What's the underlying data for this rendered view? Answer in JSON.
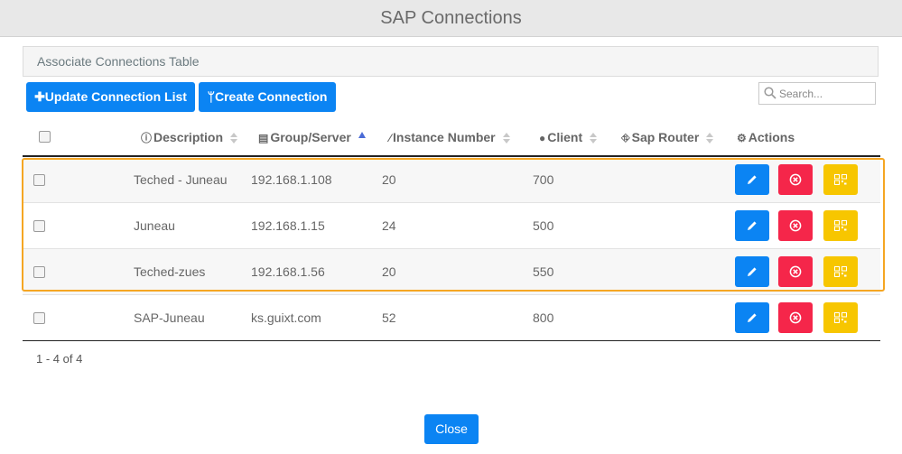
{
  "modal": {
    "title": "SAP Connections"
  },
  "panel": {
    "heading": "Associate Connections Table"
  },
  "toolbar": {
    "update_label": "Update Connection List",
    "create_label": "Create Connection",
    "search_placeholder": "Search..."
  },
  "columns": {
    "description": "Description",
    "group_server": "Group/Server",
    "instance_number": "Instance Number",
    "client": "Client",
    "sap_router": "Sap Router",
    "actions": "Actions"
  },
  "rows": [
    {
      "description": "Teched - Juneau",
      "server": "192.168.1.108",
      "instance": "20",
      "client": "700",
      "router": ""
    },
    {
      "description": "Juneau",
      "server": "192.168.1.15",
      "instance": "24",
      "client": "500",
      "router": ""
    },
    {
      "description": "Teched-zues",
      "server": "192.168.1.56",
      "instance": "20",
      "client": "550",
      "router": ""
    },
    {
      "description": "SAP-Juneau",
      "server": "ks.guixt.com",
      "instance": "52",
      "client": "800",
      "router": ""
    }
  ],
  "pager": {
    "text": "1 - 4 of 4"
  },
  "footer": {
    "close_label": "Close"
  },
  "colors": {
    "primary": "#0b84f3",
    "danger": "#f5264a",
    "warning": "#f7c600",
    "highlight": "#f5a623"
  },
  "icons": {
    "update": "plus-icon",
    "create": "branch-icon",
    "search": "search-icon",
    "description": "info-circle-icon",
    "group_server": "server-icon",
    "instance_number": "magic-wand-icon",
    "client": "user-icon",
    "sap_router": "road-icon",
    "actions": "gear-icon",
    "edit": "pencil-icon",
    "delete": "x-circle-icon",
    "qr": "qr-code-icon"
  }
}
